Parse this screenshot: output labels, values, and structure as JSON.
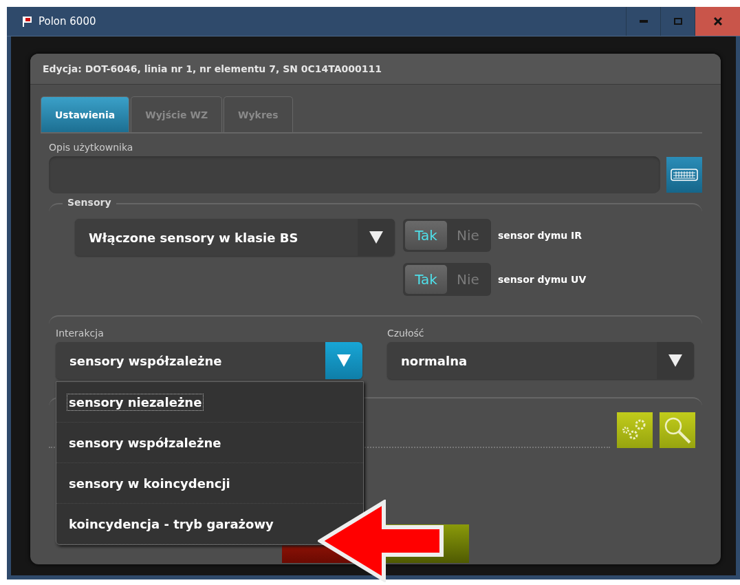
{
  "window": {
    "title": "Polon 6000"
  },
  "dialog": {
    "title": "Edycja: DOT-6046, linia nr 1, nr elementu 7, SN 0C14TA000111"
  },
  "tabs": [
    {
      "label": "Ustawienia",
      "selected": true
    },
    {
      "label": "Wyjście WZ",
      "selected": false
    },
    {
      "label": "Wykres",
      "selected": false
    }
  ],
  "user_description": {
    "label": "Opis użytkownika"
  },
  "sensors": {
    "legend": "Sensory",
    "select_value": "Włączone sensory w klasie BS",
    "toggles": [
      {
        "on_label": "Tak",
        "off_label": "Nie",
        "on": true,
        "label": "sensor dymu IR"
      },
      {
        "on_label": "Tak",
        "off_label": "Nie",
        "on": true,
        "label": "sensor dymu UV"
      }
    ]
  },
  "interaction": {
    "label": "Interakcja",
    "value": "sensory współzależne",
    "expanded": true,
    "options": [
      {
        "label": "sensory niezależne",
        "focused": true
      },
      {
        "label": "sensory współzależne",
        "focused": false
      },
      {
        "label": "sensory w koincydencji",
        "focused": false
      },
      {
        "label": "koincydencja - tryb garażowy",
        "focused": false
      }
    ]
  },
  "sensitivity": {
    "label": "Czułość",
    "value": "normalna"
  }
}
